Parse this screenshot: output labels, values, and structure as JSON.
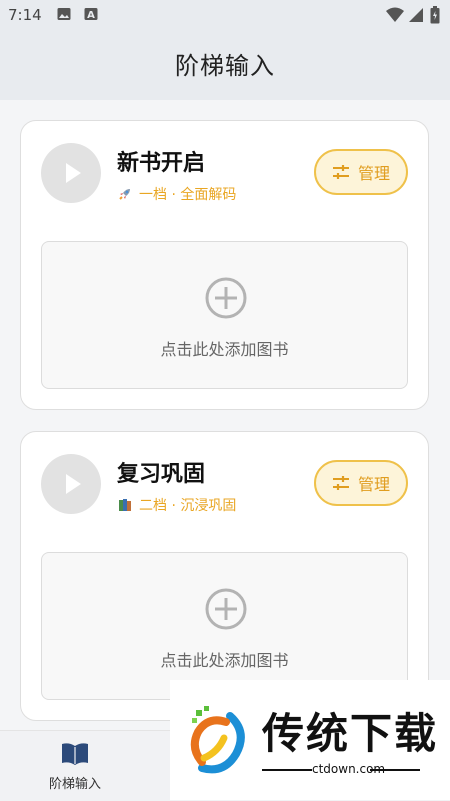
{
  "status_bar": {
    "time": "7:14",
    "left_icons": [
      "image-icon",
      "a-icon"
    ],
    "right_icons": [
      "wifi-icon",
      "signal-icon",
      "battery-icon"
    ]
  },
  "app_bar": {
    "title": "阶梯输入"
  },
  "cards": [
    {
      "title": "新书开启",
      "emoji_icon": "rocket-icon",
      "subtitle": "一档 · 全面解码",
      "manage_label": "管理",
      "add_hint": "点击此处添加图书"
    },
    {
      "title": "复习巩固",
      "emoji_icon": "books-icon",
      "subtitle": "二档 · 沉浸巩固",
      "manage_label": "管理",
      "add_hint": "点击此处添加图书"
    }
  ],
  "bottom_nav": {
    "items": [
      {
        "label": "阶梯输入",
        "icon": "open-book-icon"
      }
    ]
  },
  "watermark": {
    "brand": "传统下载",
    "domain": "ctdown.com",
    "logo": "ctdown-logo"
  },
  "colors": {
    "accent": "#e9a623",
    "manage_border": "#efc14a",
    "manage_bg": "#fdf4d9"
  }
}
